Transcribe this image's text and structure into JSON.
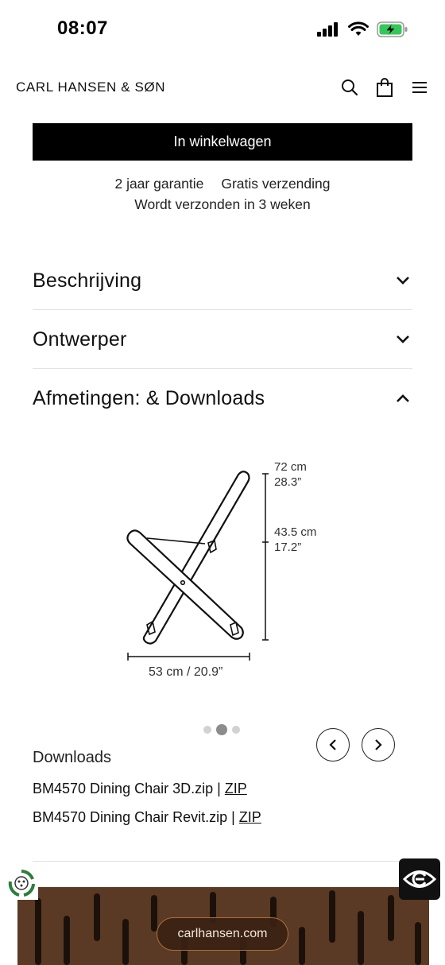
{
  "status_bar": {
    "time": "08:07"
  },
  "header": {
    "brand": "CARL HANSEN & SØN",
    "icons": [
      "search-icon",
      "shopping-bag-icon",
      "menu-icon"
    ]
  },
  "product": {
    "cart_button": "In winkelwagen",
    "usp": {
      "warranty": "2 jaar garantie",
      "shipping": "Gratis verzending",
      "delivery": "Wordt verzonden in 3 weken"
    }
  },
  "accordion": [
    {
      "title": "Beschrijving",
      "expanded": false
    },
    {
      "title": "Ontwerper",
      "expanded": false
    },
    {
      "title": "Afmetingen: & Downloads",
      "expanded": true
    }
  ],
  "dimensions": {
    "height_total": {
      "cm": "72 cm",
      "inch": "28.3”"
    },
    "seat_height": {
      "cm": "43.5 cm",
      "inch": "17.2”"
    },
    "width": "53 cm / 20.9”"
  },
  "carousel": {
    "slide_count": 3,
    "active_index": 1
  },
  "downloads": {
    "heading": "Downloads",
    "items": [
      {
        "name": "BM4570 Dining Chair 3D.zip",
        "separator": " | ",
        "link": "ZIP"
      },
      {
        "name": "BM4570 Dining Chair Revit.zip",
        "separator": " | ",
        "link": "ZIP"
      }
    ]
  },
  "footer": {
    "site_pill": "carlhansen.com"
  },
  "colors": {
    "primary_button": "#000000",
    "wood": "#5a3a24",
    "pill_border": "#a8703a",
    "battery_green": "#34c759"
  }
}
